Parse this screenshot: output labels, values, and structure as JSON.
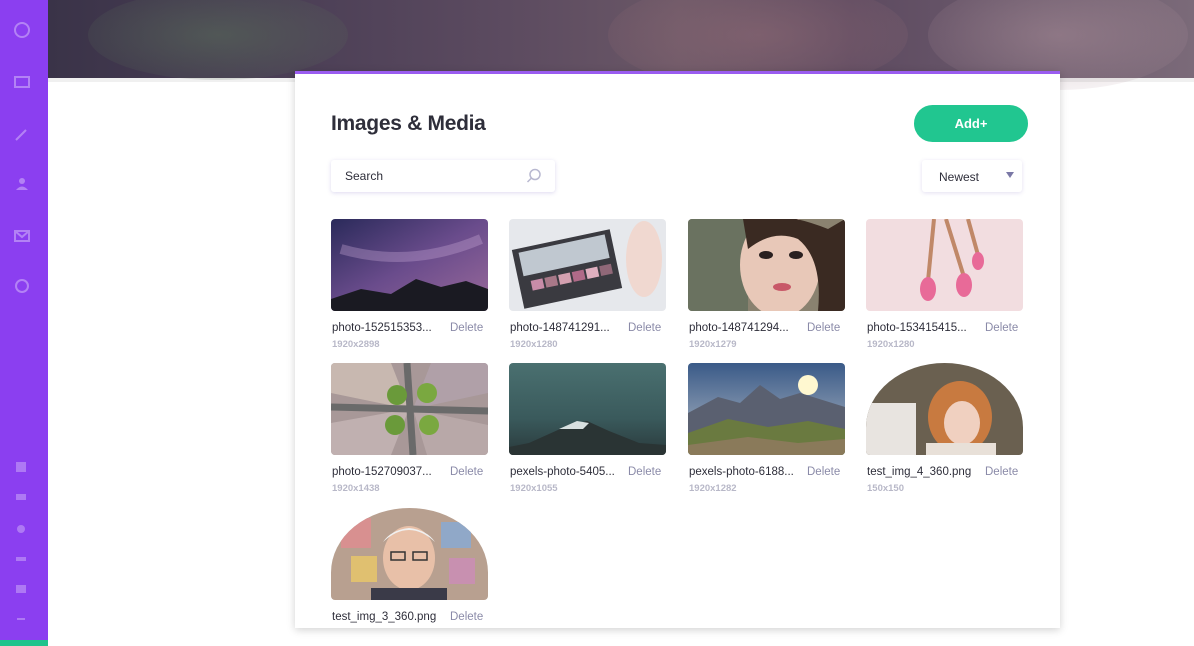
{
  "app": {
    "panel_title": "Images & Media",
    "add_label": "Add+",
    "search_placeholder": "Search",
    "sort_value": "Newest"
  },
  "colors": {
    "sidebar": "#8b3ff0",
    "accent_green": "#21c690",
    "panel_top_border": "#9a5cf0"
  },
  "icons": [
    "search-icon",
    "caret-down-icon"
  ],
  "media": [
    {
      "name": "photo-152515353...",
      "dims": "1920x2898",
      "delete": "Delete"
    },
    {
      "name": "photo-148741291...",
      "dims": "1920x1280",
      "delete": "Delete"
    },
    {
      "name": "photo-148741294...",
      "dims": "1920x1279",
      "delete": "Delete"
    },
    {
      "name": "photo-153415415...",
      "dims": "1920x1280",
      "delete": "Delete"
    },
    {
      "name": "photo-152709037...",
      "dims": "1920x1438",
      "delete": "Delete"
    },
    {
      "name": "pexels-photo-5405...",
      "dims": "1920x1055",
      "delete": "Delete"
    },
    {
      "name": "pexels-photo-6188...",
      "dims": "1920x1282",
      "delete": "Delete"
    },
    {
      "name": "test_img_4_360.png",
      "dims": "150x150",
      "delete": "Delete"
    },
    {
      "name": "test_img_3_360.png",
      "dims": "",
      "delete": "Delete"
    }
  ]
}
